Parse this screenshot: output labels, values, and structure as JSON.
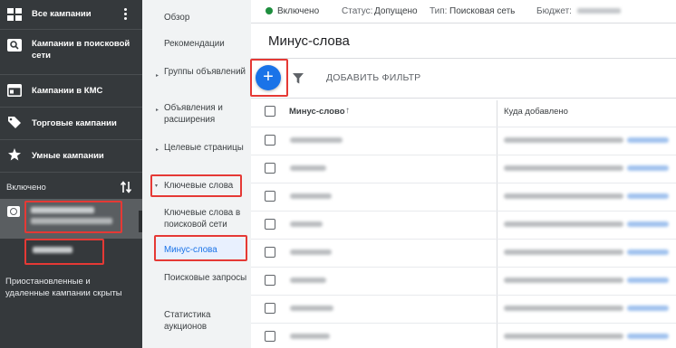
{
  "sidebar": {
    "items": [
      {
        "label": "Все кампании",
        "icon": "grid-icon"
      },
      {
        "label": "Кампании в поисковой сети",
        "icon": "search-campaign-icon"
      },
      {
        "label": "Кампании в КМС",
        "icon": "display-campaign-icon"
      },
      {
        "label": "Торговые кампании",
        "icon": "shopping-tag-icon"
      },
      {
        "label": "Умные кампании",
        "icon": "smart-campaign-icon"
      }
    ],
    "filter_label": "Включено",
    "hidden_note": "Приостановленные и удаленные кампании скрыты"
  },
  "nav": {
    "items": [
      {
        "label": "Обзор"
      },
      {
        "label": "Рекомендации"
      },
      {
        "label": "Группы объявлений"
      },
      {
        "label": "Объявления и расширения"
      },
      {
        "label": "Целевые страницы"
      },
      {
        "label": "Ключевые слова"
      },
      {
        "label": "Ключевые слова в поисковой сети"
      },
      {
        "label": "Минус-слова"
      },
      {
        "label": "Поисковые запросы"
      },
      {
        "label": "Статистика аукционов"
      }
    ]
  },
  "topbar": {
    "state": "Включено",
    "status_label": "Статус:",
    "status_value": "Допущено",
    "type_label": "Тип:",
    "type_value": "Поисковая сеть",
    "budget_label": "Бюджет:"
  },
  "page": {
    "title": "Минус-слова",
    "add_filter": "ДОБАВИТЬ ФИЛЬТР"
  },
  "table": {
    "columns": [
      "Минус-слово",
      "Куда добавлено"
    ],
    "row_count": 8
  },
  "colors": {
    "sidebar_bg": "#35393c",
    "accent": "#1a73e8",
    "highlight": "#e53935",
    "status_ok": "#1e8e3e"
  }
}
